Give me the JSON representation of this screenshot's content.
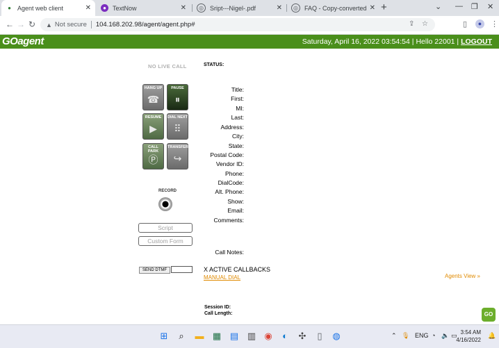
{
  "browser": {
    "tabs": [
      {
        "title": "Agent web client",
        "icon": "agent-favicon",
        "active": true
      },
      {
        "title": "TextNow",
        "icon": "textnow-favicon",
        "active": false
      },
      {
        "title": "Sript---Nigel-.pdf",
        "icon": "globe-favicon",
        "active": false
      },
      {
        "title": "FAQ - Copy-converted.pdf",
        "icon": "globe-favicon",
        "active": false
      }
    ],
    "security_text": "Not secure",
    "url": "104.168.202.98/agent/agent.php#"
  },
  "header": {
    "logo": "GOagent",
    "datetime": "Saturday, April 16, 2022 03:54:54",
    "greeting": "Hello 22001",
    "logout": "LOGOUT",
    "color": "#4a8f1b"
  },
  "controls": {
    "no_live_call": "NO LIVE CALL",
    "buttons": [
      {
        "label": "HANG UP",
        "icon": "phone-hangup-icon"
      },
      {
        "label": "PAUSE",
        "icon": "pause-icon"
      },
      {
        "label": "RESUME",
        "icon": "play-icon"
      },
      {
        "label": "DIAL NEXT",
        "icon": "dialpad-icon"
      },
      {
        "label": "CALL PARK",
        "icon": "park-icon"
      },
      {
        "label": "TRANSFER",
        "icon": "transfer-icon"
      }
    ],
    "record_label": "RECORD",
    "script_button": "Script",
    "custom_form_button": "Custom Form",
    "send_dtmf": "SEND DTMF",
    "dtmf_value": ""
  },
  "form": {
    "status_label": "STATUS:",
    "fields": [
      "Title:",
      "First:",
      "MI:",
      "Last:",
      "Address:",
      "City:",
      "State:",
      "Postal Code:",
      "Vendor ID:",
      "Phone:",
      "DialCode:",
      "Alt. Phone:",
      "Show:",
      "Email:",
      "Comments:"
    ],
    "call_notes": "Call Notes:",
    "active_callbacks": "X ACTIVE CALLBACKS",
    "manual_dial": "MANUAL DIAL",
    "agents_view": "Agents View »",
    "session_id": "Session ID:",
    "call_length": "Call Length:",
    "go_badge": "GO"
  },
  "taskbar": {
    "language": "ENG",
    "time": "3:54 AM",
    "date": "4/16/2022"
  }
}
